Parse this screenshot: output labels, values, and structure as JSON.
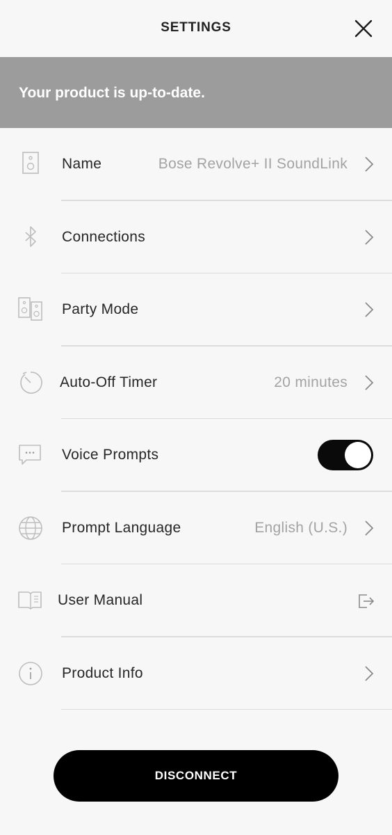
{
  "header": {
    "title": "SETTINGS",
    "close_icon": "close-icon"
  },
  "banner": {
    "text": "Your product is up-to-date."
  },
  "settings": [
    {
      "id": "name",
      "icon": "speaker-icon",
      "label": "Name",
      "value": "Bose Revolve+ II SoundLink",
      "trailing": "chevron"
    },
    {
      "id": "connections",
      "icon": "bluetooth-icon",
      "label": "Connections",
      "value": "",
      "trailing": "chevron"
    },
    {
      "id": "party-mode",
      "icon": "party-speakers-icon",
      "label": "Party Mode",
      "value": "",
      "trailing": "chevron"
    },
    {
      "id": "auto-off-timer",
      "icon": "timer-icon",
      "label": "Auto-Off Timer",
      "value": "20 minutes",
      "trailing": "chevron"
    },
    {
      "id": "voice-prompts",
      "icon": "speech-bubble-icon",
      "label": "Voice Prompts",
      "value": "",
      "trailing": "toggle",
      "toggle_on": true
    },
    {
      "id": "prompt-language",
      "icon": "globe-icon",
      "label": "Prompt Language",
      "value": "English (U.S.)",
      "trailing": "chevron"
    },
    {
      "id": "user-manual",
      "icon": "book-icon",
      "label": "User Manual",
      "value": "",
      "trailing": "external-link"
    },
    {
      "id": "product-info",
      "icon": "info-icon",
      "label": "Product Info",
      "value": "",
      "trailing": "chevron"
    }
  ],
  "footer": {
    "disconnect_label": "DISCONNECT"
  },
  "colors": {
    "background": "#f7f7f7",
    "banner": "#9c9c9c",
    "button": "#000000",
    "secondary_text": "#a3a3a3"
  }
}
